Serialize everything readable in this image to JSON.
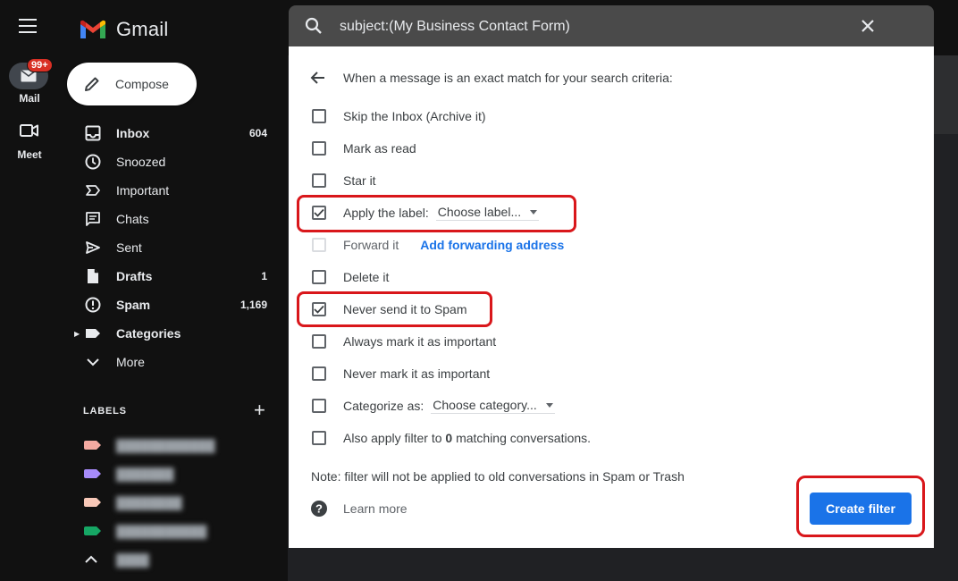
{
  "rail": {
    "mail_label": "Mail",
    "mail_badge": "99+",
    "meet_label": "Meet"
  },
  "sidebar": {
    "logo_text": "Gmail",
    "compose_label": "Compose",
    "nav": [
      {
        "label": "Inbox",
        "count": "604",
        "icon": "inbox-icon",
        "bold": true
      },
      {
        "label": "Snoozed",
        "count": "",
        "icon": "clock-icon",
        "bold": false
      },
      {
        "label": "Important",
        "count": "",
        "icon": "important-icon",
        "bold": false
      },
      {
        "label": "Chats",
        "count": "",
        "icon": "chat-icon",
        "bold": false
      },
      {
        "label": "Sent",
        "count": "",
        "icon": "send-icon",
        "bold": false
      },
      {
        "label": "Drafts",
        "count": "1",
        "icon": "draft-icon",
        "bold": true
      },
      {
        "label": "Spam",
        "count": "1,169",
        "icon": "spam-icon",
        "bold": true
      },
      {
        "label": "Categories",
        "count": "",
        "icon": "label-icon",
        "bold": true
      },
      {
        "label": "More",
        "count": "",
        "icon": "chevron-down-icon",
        "bold": false
      }
    ],
    "labels_heading": "LABELS",
    "label_colors": [
      "#f4a9a0",
      "#a78bfa",
      "#f8c8b8",
      "#16a765"
    ]
  },
  "dialog": {
    "search_query": "subject:(My Business Contact Form)",
    "criteria_heading": "When a message is an exact match for your search criteria:",
    "options": {
      "skip_inbox": "Skip the Inbox (Archive it)",
      "mark_read": "Mark as read",
      "star": "Star it",
      "apply_label": "Apply the label:",
      "apply_label_select": "Choose label...",
      "forward": "Forward it",
      "forward_link": "Add forwarding address",
      "delete": "Delete it",
      "never_spam": "Never send it to Spam",
      "always_important": "Always mark it as important",
      "never_important": "Never mark it as important",
      "categorize": "Categorize as:",
      "categorize_select": "Choose category...",
      "also_apply_prefix": "Also apply filter to ",
      "also_apply_count": "0",
      "also_apply_suffix": " matching conversations."
    },
    "checked": {
      "apply_label": true,
      "never_spam": true
    },
    "note": "Note: filter will not be applied to old conversations in Spam or Trash",
    "learn_more": "Learn more",
    "create_button": "Create filter",
    "colors": {
      "primary_button": "#1a73e8",
      "highlight": "#d9171b"
    }
  }
}
